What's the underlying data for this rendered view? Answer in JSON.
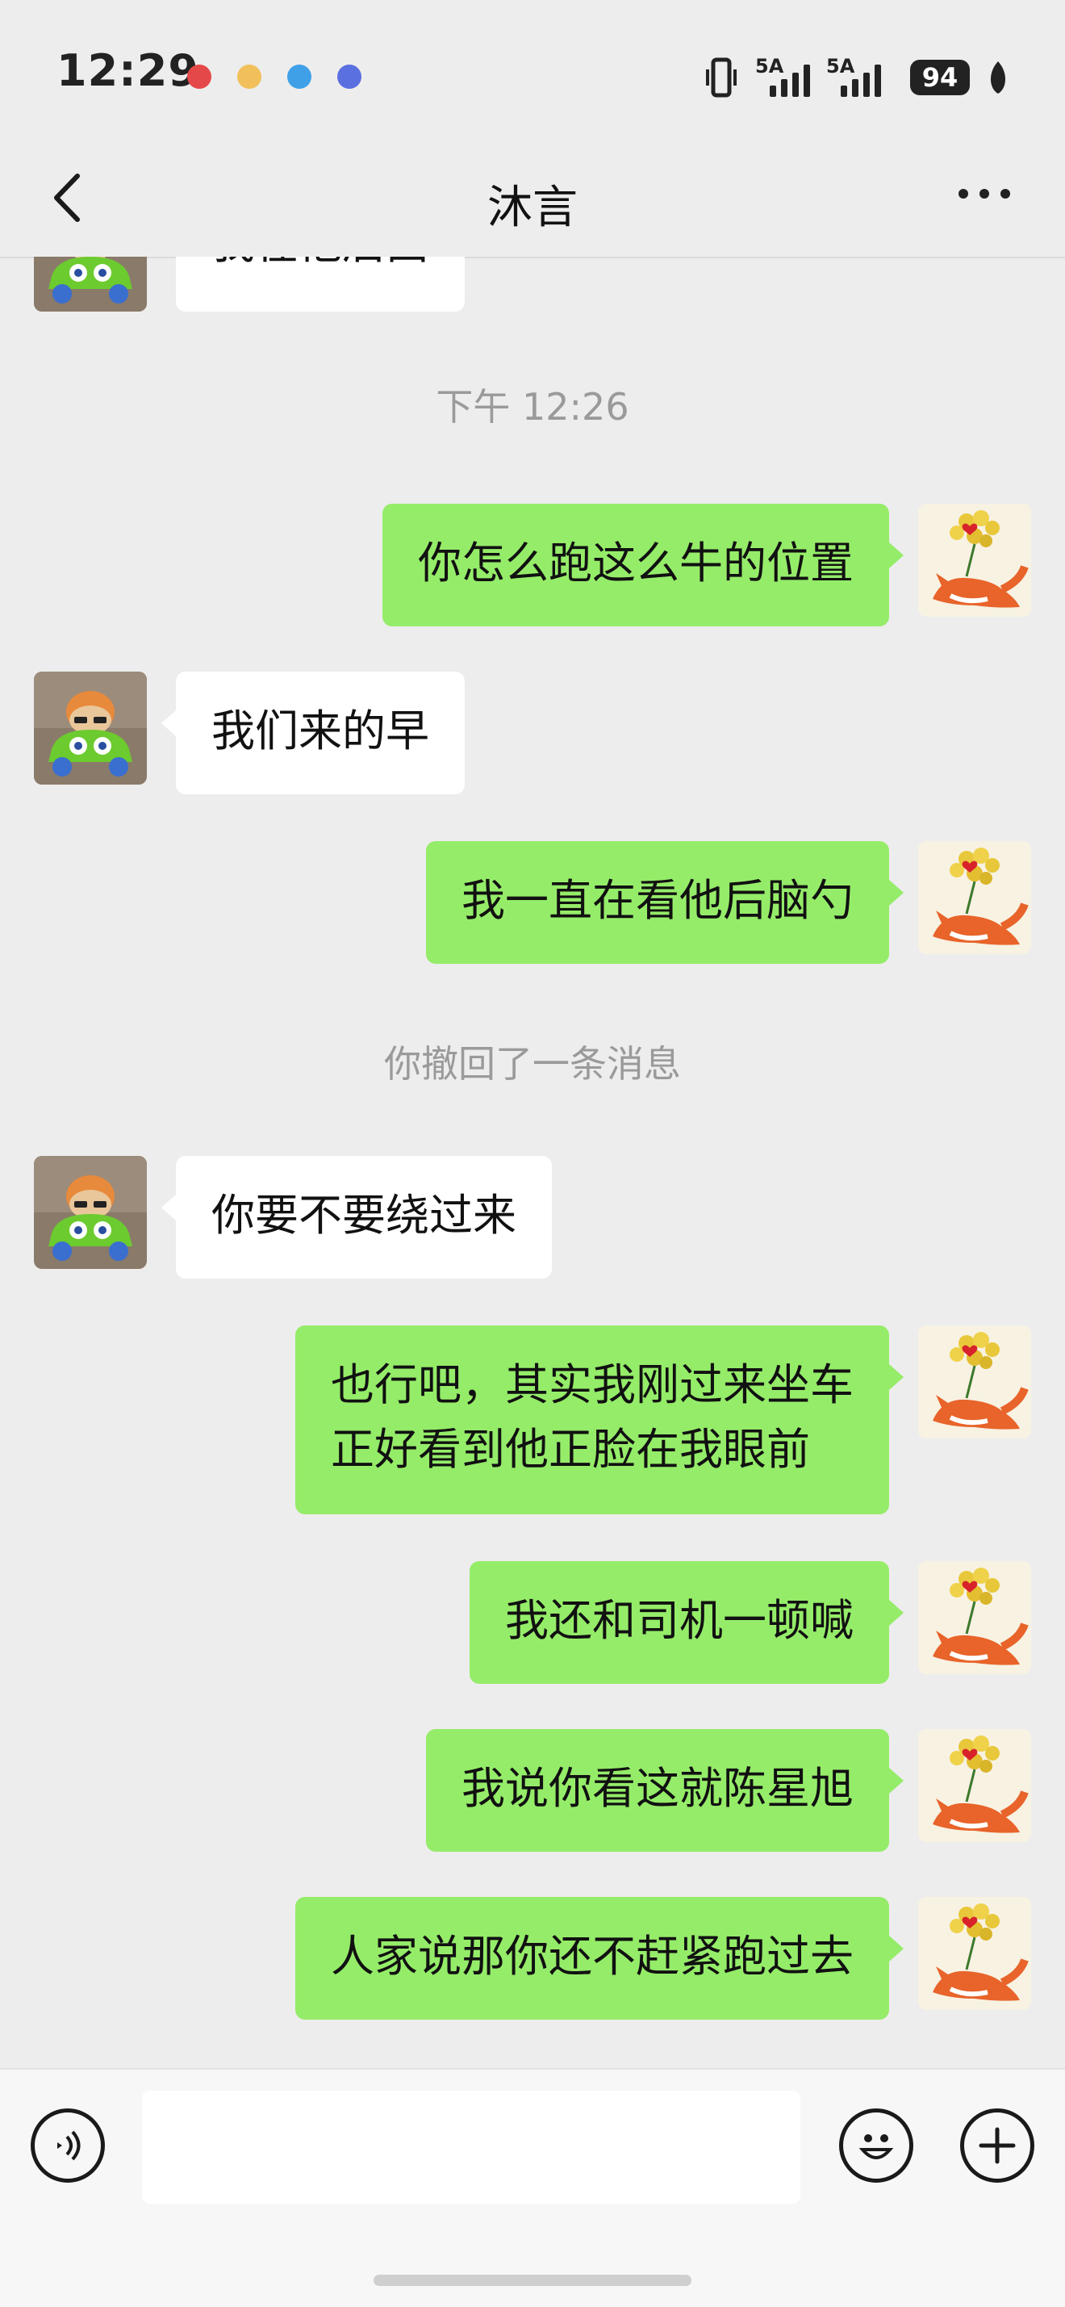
{
  "status_bar": {
    "time": "12:29",
    "network1": "5A",
    "network2": "5A",
    "battery": "94",
    "notification_icons": [
      "huawei-music-icon",
      "pet-app-icon",
      "message-app-icon",
      "browser-app-icon"
    ]
  },
  "nav": {
    "title": "沐言",
    "back_icon": "chevron-left-icon",
    "more_icon": "more-dots-icon"
  },
  "messages": [
    {
      "type": "text",
      "side": "in",
      "text": "我在他后面",
      "partially_cut": true
    },
    {
      "type": "system",
      "text": "下午 12:26"
    },
    {
      "type": "text",
      "side": "out",
      "text": "你怎么跑这么牛的位置"
    },
    {
      "type": "text",
      "side": "in",
      "text": "我们来的早"
    },
    {
      "type": "text",
      "side": "out",
      "text": "我一直在看他后脑勺"
    },
    {
      "type": "system",
      "text": "你撤回了一条消息"
    },
    {
      "type": "text",
      "side": "in",
      "text": "你要不要绕过来"
    },
    {
      "type": "text",
      "side": "out",
      "lines": [
        "也行吧，其实我刚过来坐车",
        "正好看到他正脸在我眼前"
      ]
    },
    {
      "type": "text",
      "side": "out",
      "text": "我还和司机一顿喊"
    },
    {
      "type": "text",
      "side": "out",
      "text": "我说你看这就陈星旭"
    },
    {
      "type": "text",
      "side": "out",
      "text": "人家说那你还不赶紧跑过去"
    }
  ],
  "avatars": {
    "contact": "toy-car-avatar",
    "me": "fox-with-flowers-avatar"
  },
  "colors": {
    "background": "#EDEDED",
    "outgoing_bubble": "#95EC69",
    "incoming_bubble": "#FFFFFF",
    "system_text": "#9A9A9A"
  },
  "input": {
    "value": "",
    "voice_icon": "voice-icon",
    "emoji_icon": "emoji-icon",
    "plus_icon": "plus-icon"
  }
}
